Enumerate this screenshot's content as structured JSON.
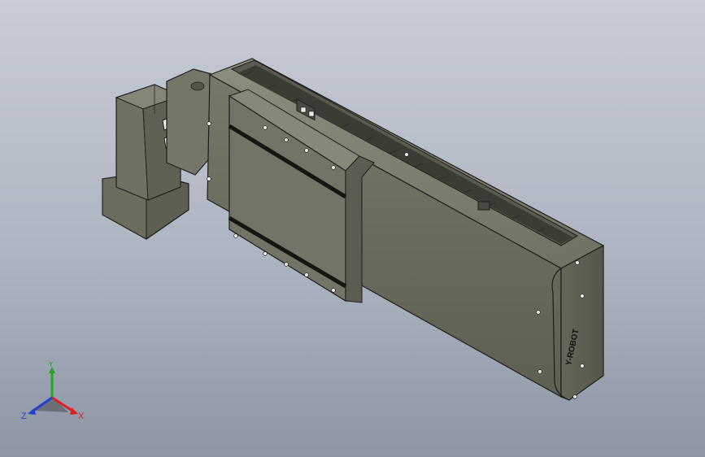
{
  "viewport": {
    "background_top": "#c7ccd6",
    "background_bottom": "#8d95a5"
  },
  "model": {
    "body_color": "#6e6e60",
    "dark_color": "#3a3a33",
    "light_color": "#8a8a7a",
    "brand_label": "Y-ROBOT"
  },
  "triad": {
    "x_label": "X",
    "y_label": "Y",
    "z_label": "Z",
    "x_color": "#e02020",
    "y_color": "#22a822",
    "z_color": "#2040d0"
  }
}
